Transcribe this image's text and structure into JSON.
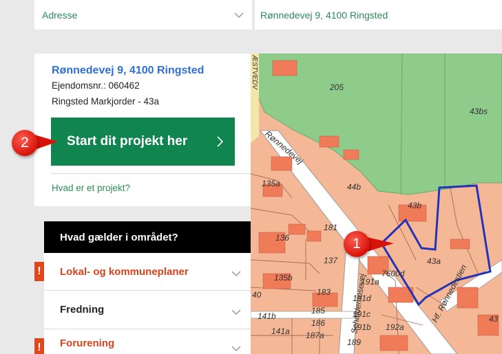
{
  "address_bar": {
    "field_label": "Adresse",
    "field_value": "Rønnedevej 9, 4100 Ringsted"
  },
  "property": {
    "title": "Rønnedevej 9, 4100 Ringsted",
    "property_number": "Ejendomsnr.: 060462",
    "cadastre": "Ringsted Markjorder - 43a",
    "start_button_label": "Start dit projekt her",
    "project_link": "Hvad er et projekt?"
  },
  "callouts": {
    "one": "1",
    "two": "2"
  },
  "rules": {
    "heading": "Hvad gælder i området?",
    "items": [
      {
        "label": "Lokal- og kommuneplaner",
        "warning": true,
        "warning_mark": "!"
      },
      {
        "label": "Fredning",
        "warning": false
      },
      {
        "label": "Forurening",
        "warning": true,
        "warning_mark": "!"
      }
    ]
  },
  "map": {
    "street_labels": [
      "Rønnedevej",
      "Schaldemosevej",
      "Hf. Rønnedestien",
      "ÆSTVEDV"
    ],
    "parcel_labels": [
      "205",
      "43bs",
      "135a",
      "44b",
      "43b",
      "181",
      "136",
      "137",
      "43a",
      "135b",
      "7600d",
      "191a",
      "183",
      "191d",
      "191c",
      "191b",
      "185",
      "186",
      "187a",
      "189",
      "141b",
      "141a",
      "192a",
      "40",
      "43"
    ]
  },
  "colors": {
    "accent_green": "#11854f",
    "link_green": "#2a8b57",
    "title_blue": "#2f6fd6",
    "warning": "#e0481c",
    "badge_red": "#d8140a",
    "outline_blue": "#2432b8"
  }
}
